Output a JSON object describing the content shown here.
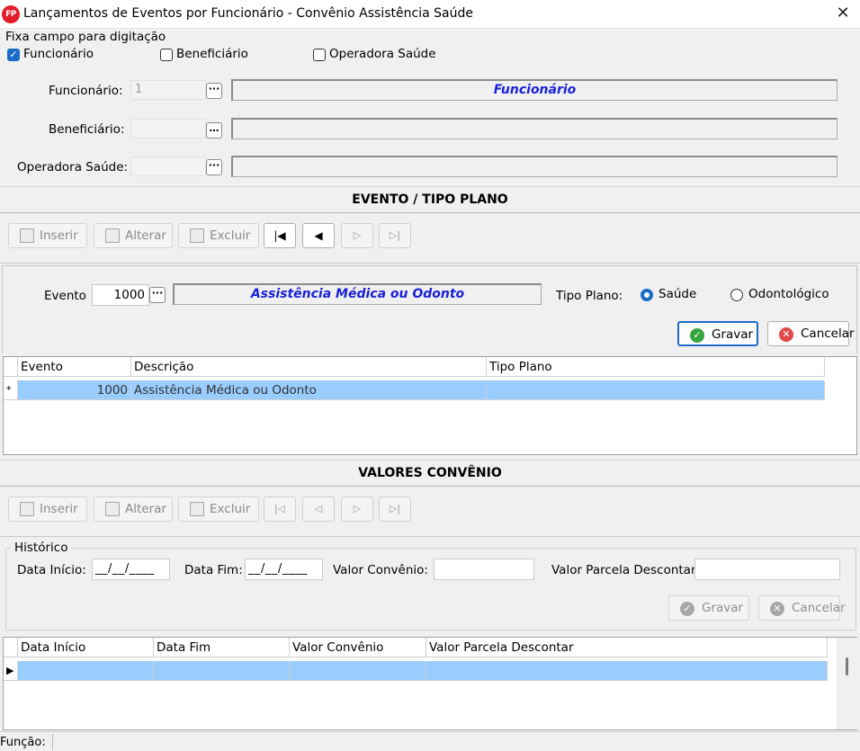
{
  "window": {
    "title": "Lançamentos de Eventos por Funcionário - Convênio Assistência Saúde",
    "icon_text": "FP",
    "close": "✕"
  },
  "fixa": {
    "legend": "Fixa campo para digitação",
    "items": [
      {
        "label": "Funcionário",
        "checked": true
      },
      {
        "label": "Beneficiário",
        "checked": false
      },
      {
        "label": "Operadora Saúde",
        "checked": false
      }
    ]
  },
  "fields": {
    "funcionario": {
      "label": "Funcionário:",
      "value": "1",
      "display": "Funcionário"
    },
    "beneficiario": {
      "label": "Beneficiário:",
      "value": "",
      "display": ""
    },
    "operadora": {
      "label": "Operadora Saúde:",
      "value": "",
      "display": ""
    }
  },
  "section1": {
    "title": "EVENTO / TIPO PLANO"
  },
  "toolbar": {
    "inserir": "Inserir",
    "alterar": "Alterar",
    "excluir": "Excluir"
  },
  "evento": {
    "label": "Evento",
    "value": "1000",
    "display": "Assistência Médica ou Odonto",
    "tipo_label": "Tipo Plano:",
    "options": [
      "Saúde",
      "Odontológico"
    ],
    "selected": "Saúde",
    "gravar": "Gravar",
    "cancelar": "Cancelar"
  },
  "grid1": {
    "columns": [
      "Evento",
      "Descrição",
      "Tipo Plano"
    ],
    "rows": [
      {
        "marker": "*",
        "evento": "1000",
        "descricao": "Assistência Médica ou Odonto",
        "tipo": ""
      }
    ]
  },
  "section2": {
    "title": "VALORES CONVÊNIO"
  },
  "historico": {
    "legend": "Histórico",
    "data_inicio_label": "Data Início:",
    "data_inicio_value": "__/__/____",
    "data_fim_label": "Data Fim:",
    "data_fim_value": "__/__/____",
    "valor_label": "Valor Convênio:",
    "valor_value": "",
    "parcela_label": "Valor Parcela Descontar:",
    "parcela_value": "",
    "gravar": "Gravar",
    "cancelar": "Cancelar"
  },
  "grid2": {
    "columns": [
      "Data Início",
      "Data Fim",
      "Valor Convênio",
      "Valor Parcela Descontar"
    ],
    "rows": [
      {
        "marker": "▶",
        "data_inicio": "",
        "data_fim": "",
        "valor": "",
        "parcela": ""
      }
    ]
  },
  "status": {
    "label": "Função:"
  },
  "colors": {
    "accent": "#1a6dc7",
    "selection": "#99ccff",
    "display_text": "#1a22d8",
    "ok": "#35a63f",
    "cancel": "#e14a48"
  }
}
